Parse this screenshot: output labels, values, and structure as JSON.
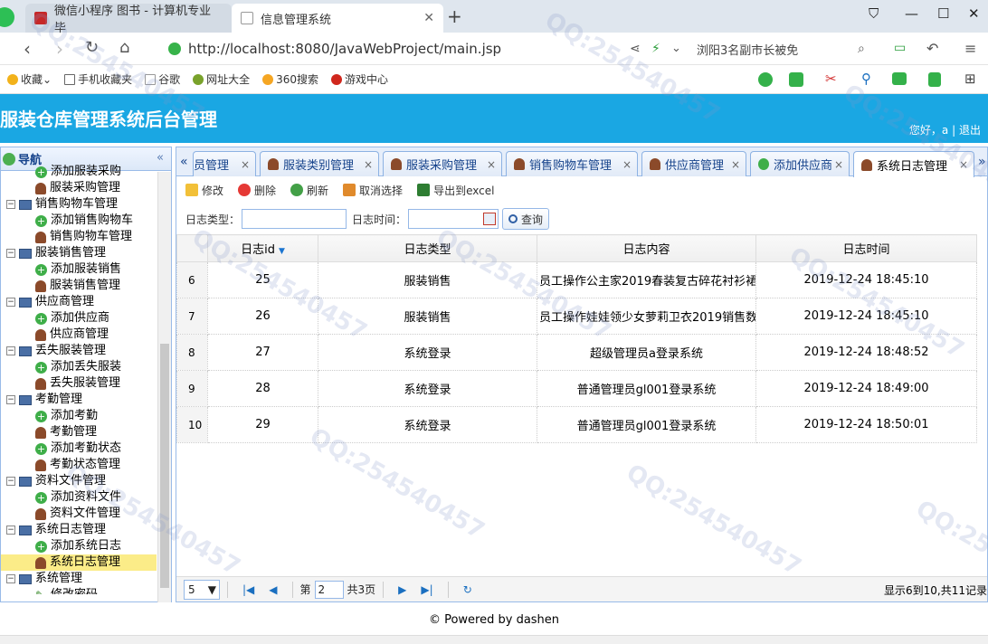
{
  "browser": {
    "tabs": [
      {
        "title": "微信小程序 图书 - 计算机专业毕",
        "active": false
      },
      {
        "title": "信息管理系统",
        "active": true
      }
    ],
    "url": "http://localhost:8080/JavaWebProject/main.jsp",
    "search_text": "浏阳3名副市长被免",
    "favorites": [
      "收藏",
      "手机收藏夹",
      "谷歌",
      "网址大全",
      "360搜索",
      "游戏中心"
    ]
  },
  "app": {
    "title": "服装仓库管理系统后台管理",
    "greeting": "您好，a",
    "separator": "|",
    "logout": "退出"
  },
  "sidebar": {
    "title": "导航",
    "collapse": "«",
    "nodes": [
      {
        "label": "添加服装采购",
        "kind": "leaf",
        "icon": "plus"
      },
      {
        "label": "服装采购管理",
        "kind": "leaf",
        "icon": "person"
      },
      {
        "label": "销售购物车管理",
        "kind": "folder"
      },
      {
        "label": "添加销售购物车",
        "kind": "leaf",
        "icon": "plus"
      },
      {
        "label": "销售购物车管理",
        "kind": "leaf",
        "icon": "person"
      },
      {
        "label": "服装销售管理",
        "kind": "folder"
      },
      {
        "label": "添加服装销售",
        "kind": "leaf",
        "icon": "plus"
      },
      {
        "label": "服装销售管理",
        "kind": "leaf",
        "icon": "person"
      },
      {
        "label": "供应商管理",
        "kind": "folder"
      },
      {
        "label": "添加供应商",
        "kind": "leaf",
        "icon": "plus"
      },
      {
        "label": "供应商管理",
        "kind": "leaf",
        "icon": "person"
      },
      {
        "label": "丢失服装管理",
        "kind": "folder"
      },
      {
        "label": "添加丢失服装",
        "kind": "leaf",
        "icon": "plus"
      },
      {
        "label": "丢失服装管理",
        "kind": "leaf",
        "icon": "person"
      },
      {
        "label": "考勤管理",
        "kind": "folder"
      },
      {
        "label": "添加考勤",
        "kind": "leaf",
        "icon": "plus"
      },
      {
        "label": "考勤管理",
        "kind": "leaf",
        "icon": "person"
      },
      {
        "label": "添加考勤状态",
        "kind": "leaf",
        "icon": "plus"
      },
      {
        "label": "考勤状态管理",
        "kind": "leaf",
        "icon": "person"
      },
      {
        "label": "资料文件管理",
        "kind": "folder"
      },
      {
        "label": "添加资料文件",
        "kind": "leaf",
        "icon": "plus"
      },
      {
        "label": "资料文件管理",
        "kind": "leaf",
        "icon": "person"
      },
      {
        "label": "系统日志管理",
        "kind": "folder"
      },
      {
        "label": "添加系统日志",
        "kind": "leaf",
        "icon": "plus"
      },
      {
        "label": "系统日志管理",
        "kind": "leaf",
        "icon": "person",
        "selected": true
      },
      {
        "label": "系统管理",
        "kind": "folder"
      },
      {
        "label": "修改密码",
        "kind": "leaf",
        "icon": "pencil"
      }
    ]
  },
  "main": {
    "tabs": [
      {
        "label": "员管理",
        "icon": "person"
      },
      {
        "label": "服装类别管理",
        "icon": "person"
      },
      {
        "label": "服装采购管理",
        "icon": "person"
      },
      {
        "label": "销售购物车管理",
        "icon": "person"
      },
      {
        "label": "供应商管理",
        "icon": "person"
      },
      {
        "label": "添加供应商",
        "icon": "plus"
      },
      {
        "label": "系统日志管理",
        "icon": "person",
        "active": true
      }
    ],
    "toolbar": {
      "edit": "修改",
      "delete": "删除",
      "refresh": "刷新",
      "cancel_select": "取消选择",
      "export": "导出到excel"
    },
    "filters": {
      "type_label": "日志类型：",
      "type_value": "",
      "time_label": "日志时间：",
      "time_value": "",
      "query": "查询"
    },
    "grid": {
      "columns": [
        "日志id",
        "日志类型",
        "日志内容",
        "日志时间"
      ],
      "rows": [
        {
          "rownum": "6",
          "id": "25",
          "type": "服装销售",
          "content": "员工操作公主家2019春装复古碎花衬衫裙",
          "time": "2019-12-24 18:45:10"
        },
        {
          "rownum": "7",
          "id": "26",
          "type": "服装销售",
          "content": "员工操作娃娃领少女萝莉卫衣2019销售数",
          "time": "2019-12-24 18:45:10"
        },
        {
          "rownum": "8",
          "id": "27",
          "type": "系统登录",
          "content": "超级管理员a登录系统",
          "time": "2019-12-24 18:48:52"
        },
        {
          "rownum": "9",
          "id": "28",
          "type": "系统登录",
          "content": "普通管理员gl001登录系统",
          "time": "2019-12-24 18:49:00"
        },
        {
          "rownum": "10",
          "id": "29",
          "type": "系统登录",
          "content": "普通管理员gl001登录系统",
          "time": "2019-12-24 18:50:01"
        }
      ]
    },
    "pager": {
      "page_size": "5",
      "page_prefix": "第",
      "page_value": "2",
      "page_total": "共3页",
      "info": "显示6到10,共11记录"
    }
  },
  "footer": {
    "text": "© Powered by dashen"
  },
  "watermark": "QQ:254540457"
}
